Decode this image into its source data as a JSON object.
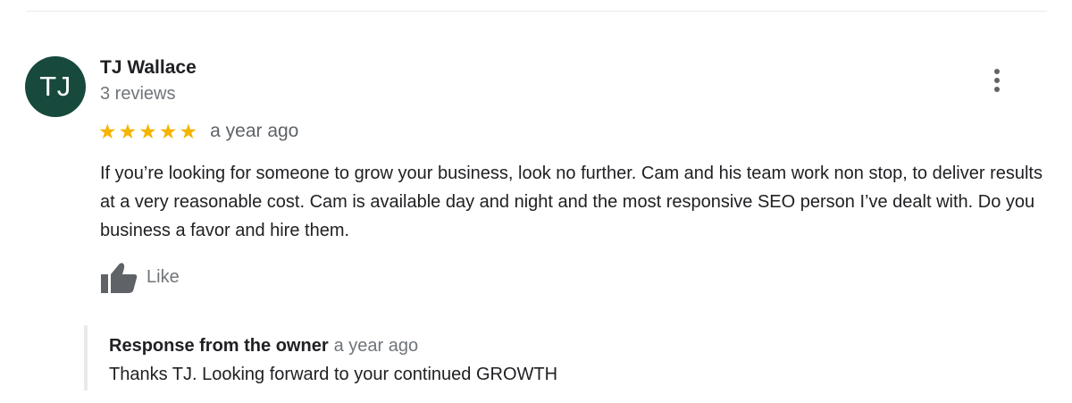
{
  "review": {
    "avatar_initials": "TJ",
    "reviewer_name": "TJ Wallace",
    "reviewer_meta": "3 reviews",
    "rating": 5,
    "rating_max": 5,
    "star_glyphs": [
      "★",
      "★",
      "★",
      "★",
      "★"
    ],
    "date": "a year ago",
    "text": "If you’re looking for someone to grow your business, look no further. Cam and his team work non stop, to deliver results at a very reasonable cost. Cam is available day and night and the most responsive SEO person I’ve dealt with. Do you business a favor and hire them.",
    "like_label": "Like"
  },
  "owner_response": {
    "title": "Response from the owner",
    "date": "a year ago",
    "text": "Thanks TJ. Looking forward to your continued GROWTH"
  },
  "icons": {
    "more": "more-vert-icon",
    "like": "thumbs-up-icon",
    "star": "star-icon"
  },
  "colors": {
    "avatar_bg": "#174a3c",
    "star": "#f4b400",
    "secondary_text": "#70757a",
    "primary_text": "#202124"
  }
}
